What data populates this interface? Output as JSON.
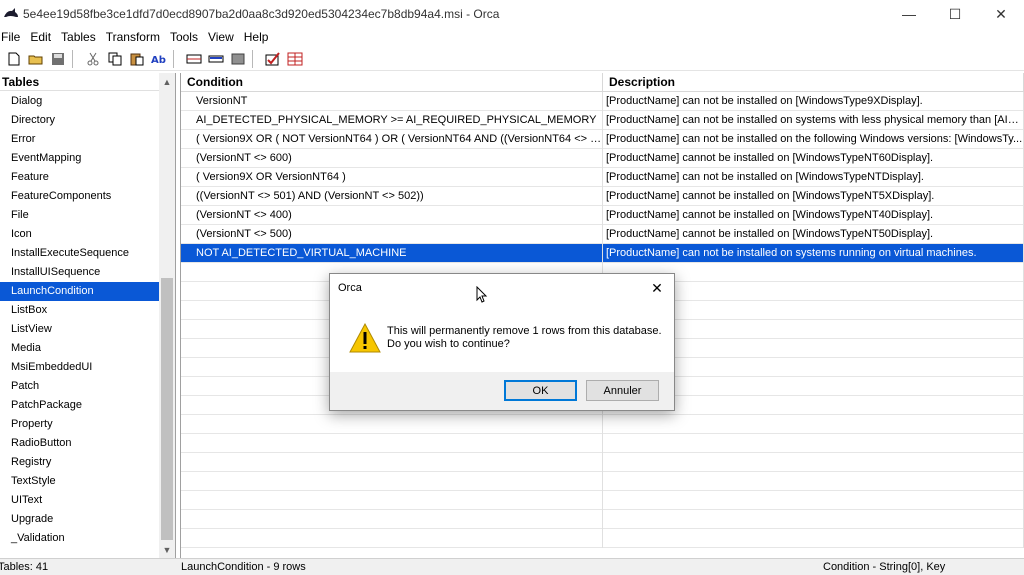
{
  "window": {
    "title": "5e4ee19d58fbe3ce1dfd7d0ecd8907ba2d0aa8c3d920ed5304234ec7b8db94a4.msi - Orca",
    "minimize": "—",
    "maximize": "☐",
    "close": "✕"
  },
  "menu": [
    "File",
    "Edit",
    "Tables",
    "Transform",
    "Tools",
    "View",
    "Help"
  ],
  "left_pane": {
    "header": "Tables",
    "items": [
      "Dialog",
      "Directory",
      "Error",
      "EventMapping",
      "Feature",
      "FeatureComponents",
      "File",
      "Icon",
      "InstallExecuteSequence",
      "InstallUISequence",
      "LaunchCondition",
      "ListBox",
      "ListView",
      "Media",
      "MsiEmbeddedUI",
      "Patch",
      "PatchPackage",
      "Property",
      "RadioButton",
      "Registry",
      "TextStyle",
      "UIText",
      "Upgrade",
      "_Validation"
    ],
    "selected": "LaunchCondition"
  },
  "table": {
    "columns": [
      "Condition",
      "Description"
    ],
    "rows": [
      [
        "VersionNT",
        "[ProductName] can not be installed on [WindowsType9XDisplay]."
      ],
      [
        "AI_DETECTED_PHYSICAL_MEMORY >= AI_REQUIRED_PHYSICAL_MEMORY",
        "[ProductName] can not be installed on systems with less physical memory than [AI_R..."
      ],
      [
        "( Version9X OR ( NOT VersionNT64 ) OR ( VersionNT64 AND ((VersionNT64 <> 601) ...",
        "[ProductName] can not be installed on the following Windows versions: [WindowsTy..."
      ],
      [
        "(VersionNT <> 600)",
        "[ProductName] cannot be installed on [WindowsTypeNT60Display]."
      ],
      [
        "( Version9X OR VersionNT64 )",
        "[ProductName] can not be installed on [WindowsTypeNTDisplay]."
      ],
      [
        "((VersionNT <> 501) AND (VersionNT <> 502))",
        "[ProductName] cannot be installed on [WindowsTypeNT5XDisplay]."
      ],
      [
        "(VersionNT <> 400)",
        "[ProductName] cannot be installed on [WindowsTypeNT40Display]."
      ],
      [
        "(VersionNT <> 500)",
        "[ProductName] cannot be installed on [WindowsTypeNT50Display]."
      ],
      [
        "NOT AI_DETECTED_VIRTUAL_MACHINE",
        "[ProductName] can not be installed on systems running on virtual machines."
      ]
    ],
    "selected_row": 8
  },
  "status": {
    "tables_count": "Tables: 41",
    "table_info": "LaunchCondition - 9 rows",
    "column_info": "Condition - String[0], Key"
  },
  "dialog": {
    "title": "Orca",
    "line1": "This will permanently remove 1 rows from this database.",
    "line2": "Do you wish to continue?",
    "ok_label": "OK",
    "cancel_label": "Annuler"
  },
  "colors": {
    "selection": "#0a58d6",
    "warning": "#f7c600"
  }
}
